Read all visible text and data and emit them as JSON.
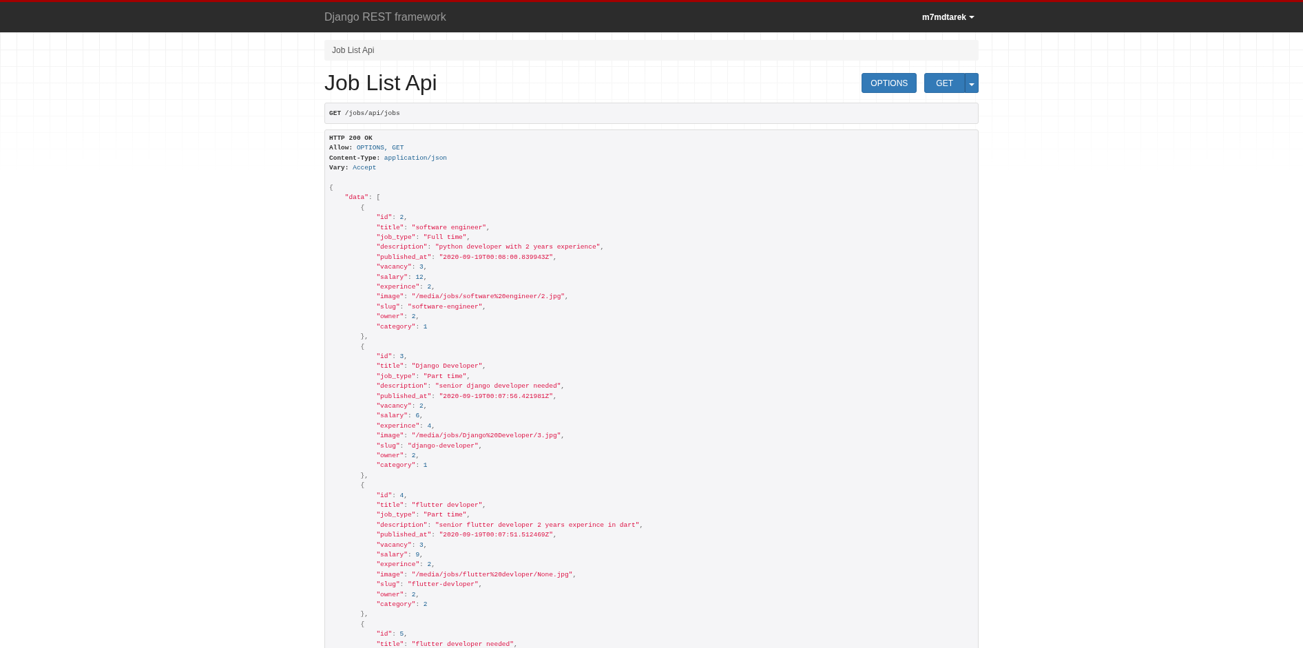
{
  "navbar": {
    "brand": "Django REST framework",
    "user": "m7mdtarek"
  },
  "breadcrumb": [
    {
      "label": "Job List Api",
      "selected": true
    }
  ],
  "title": "Job List Api",
  "buttons": [
    {
      "label": "OPTIONS",
      "kind": "plain"
    },
    {
      "label": "GET",
      "kind": "split"
    }
  ],
  "request": {
    "method": "GET",
    "path": "/jobs/api/jobs"
  },
  "response": {
    "status": "HTTP 200 OK",
    "headers": [
      {
        "name": "Allow:",
        "value": "OPTIONS, GET"
      },
      {
        "name": "Content-Type:",
        "value": "application/json"
      },
      {
        "name": "Vary:",
        "value": "Accept"
      }
    ],
    "body": {
      "open": [
        {
          "text": "{",
          "kind": "pun"
        }
      ],
      "children": [
        {
          "open": [
            {
              "text": "\"data\"",
              "kind": "str"
            },
            {
              "text": ": [",
              "kind": "pun"
            }
          ],
          "children": [
            {
              "open": [
                {
                  "text": "{",
                  "kind": "pun"
                }
              ],
              "children": [
                {
                  "open": [
                    {
                      "text": "\"id\"",
                      "kind": "str"
                    },
                    {
                      "text": ": ",
                      "kind": "pun"
                    },
                    {
                      "text": "2",
                      "kind": "lit"
                    },
                    {
                      "text": ",",
                      "kind": "pun"
                    }
                  ]
                },
                {
                  "open": [
                    {
                      "text": "\"title\"",
                      "kind": "str"
                    },
                    {
                      "text": ": ",
                      "kind": "pun"
                    },
                    {
                      "text": "\"software engineer\"",
                      "kind": "str"
                    },
                    {
                      "text": ",",
                      "kind": "pun"
                    }
                  ]
                },
                {
                  "open": [
                    {
                      "text": "\"job_type\"",
                      "kind": "str"
                    },
                    {
                      "text": ": ",
                      "kind": "pun"
                    },
                    {
                      "text": "\"Full time\"",
                      "kind": "str"
                    },
                    {
                      "text": ",",
                      "kind": "pun"
                    }
                  ]
                },
                {
                  "open": [
                    {
                      "text": "\"description\"",
                      "kind": "str"
                    },
                    {
                      "text": ": ",
                      "kind": "pun"
                    },
                    {
                      "text": "\"python developer with 2 years experience\"",
                      "kind": "str"
                    },
                    {
                      "text": ",",
                      "kind": "pun"
                    }
                  ]
                },
                {
                  "open": [
                    {
                      "text": "\"published_at\"",
                      "kind": "str"
                    },
                    {
                      "text": ": ",
                      "kind": "pun"
                    },
                    {
                      "text": "\"2020-09-19T00:08:00.839943Z\"",
                      "kind": "str"
                    },
                    {
                      "text": ",",
                      "kind": "pun"
                    }
                  ]
                },
                {
                  "open": [
                    {
                      "text": "\"vacancy\"",
                      "kind": "str"
                    },
                    {
                      "text": ": ",
                      "kind": "pun"
                    },
                    {
                      "text": "3",
                      "kind": "lit"
                    },
                    {
                      "text": ",",
                      "kind": "pun"
                    }
                  ]
                },
                {
                  "open": [
                    {
                      "text": "\"salary\"",
                      "kind": "str"
                    },
                    {
                      "text": ": ",
                      "kind": "pun"
                    },
                    {
                      "text": "12",
                      "kind": "lit"
                    },
                    {
                      "text": ",",
                      "kind": "pun"
                    }
                  ]
                },
                {
                  "open": [
                    {
                      "text": "\"experince\"",
                      "kind": "str"
                    },
                    {
                      "text": ": ",
                      "kind": "pun"
                    },
                    {
                      "text": "2",
                      "kind": "lit"
                    },
                    {
                      "text": ",",
                      "kind": "pun"
                    }
                  ]
                },
                {
                  "open": [
                    {
                      "text": "\"image\"",
                      "kind": "str"
                    },
                    {
                      "text": ": ",
                      "kind": "pun"
                    },
                    {
                      "text": "\"/media/jobs/software%20engineer/2.jpg\"",
                      "kind": "str"
                    },
                    {
                      "text": ",",
                      "kind": "pun"
                    }
                  ]
                },
                {
                  "open": [
                    {
                      "text": "\"slug\"",
                      "kind": "str"
                    },
                    {
                      "text": ": ",
                      "kind": "pun"
                    },
                    {
                      "text": "\"software-engineer\"",
                      "kind": "str"
                    },
                    {
                      "text": ",",
                      "kind": "pun"
                    }
                  ]
                },
                {
                  "open": [
                    {
                      "text": "\"owner\"",
                      "kind": "str"
                    },
                    {
                      "text": ": ",
                      "kind": "pun"
                    },
                    {
                      "text": "2",
                      "kind": "lit"
                    },
                    {
                      "text": ",",
                      "kind": "pun"
                    }
                  ]
                },
                {
                  "open": [
                    {
                      "text": "\"category\"",
                      "kind": "str"
                    },
                    {
                      "text": ": ",
                      "kind": "pun"
                    },
                    {
                      "text": "1",
                      "kind": "lit"
                    }
                  ]
                }
              ],
              "close": [
                {
                  "text": "},",
                  "kind": "pun"
                }
              ]
            },
            {
              "open": [
                {
                  "text": "{",
                  "kind": "pun"
                }
              ],
              "children": [
                {
                  "open": [
                    {
                      "text": "\"id\"",
                      "kind": "str"
                    },
                    {
                      "text": ": ",
                      "kind": "pun"
                    },
                    {
                      "text": "3",
                      "kind": "lit"
                    },
                    {
                      "text": ",",
                      "kind": "pun"
                    }
                  ]
                },
                {
                  "open": [
                    {
                      "text": "\"title\"",
                      "kind": "str"
                    },
                    {
                      "text": ": ",
                      "kind": "pun"
                    },
                    {
                      "text": "\"Django Developer\"",
                      "kind": "str"
                    },
                    {
                      "text": ",",
                      "kind": "pun"
                    }
                  ]
                },
                {
                  "open": [
                    {
                      "text": "\"job_type\"",
                      "kind": "str"
                    },
                    {
                      "text": ": ",
                      "kind": "pun"
                    },
                    {
                      "text": "\"Part time\"",
                      "kind": "str"
                    },
                    {
                      "text": ",",
                      "kind": "pun"
                    }
                  ]
                },
                {
                  "open": [
                    {
                      "text": "\"description\"",
                      "kind": "str"
                    },
                    {
                      "text": ": ",
                      "kind": "pun"
                    },
                    {
                      "text": "\"senior django developer needed\"",
                      "kind": "str"
                    },
                    {
                      "text": ",",
                      "kind": "pun"
                    }
                  ]
                },
                {
                  "open": [
                    {
                      "text": "\"published_at\"",
                      "kind": "str"
                    },
                    {
                      "text": ": ",
                      "kind": "pun"
                    },
                    {
                      "text": "\"2020-09-19T00:07:56.421981Z\"",
                      "kind": "str"
                    },
                    {
                      "text": ",",
                      "kind": "pun"
                    }
                  ]
                },
                {
                  "open": [
                    {
                      "text": "\"vacancy\"",
                      "kind": "str"
                    },
                    {
                      "text": ": ",
                      "kind": "pun"
                    },
                    {
                      "text": "2",
                      "kind": "lit"
                    },
                    {
                      "text": ",",
                      "kind": "pun"
                    }
                  ]
                },
                {
                  "open": [
                    {
                      "text": "\"salary\"",
                      "kind": "str"
                    },
                    {
                      "text": ": ",
                      "kind": "pun"
                    },
                    {
                      "text": "6",
                      "kind": "lit"
                    },
                    {
                      "text": ",",
                      "kind": "pun"
                    }
                  ]
                },
                {
                  "open": [
                    {
                      "text": "\"experince\"",
                      "kind": "str"
                    },
                    {
                      "text": ": ",
                      "kind": "pun"
                    },
                    {
                      "text": "4",
                      "kind": "lit"
                    },
                    {
                      "text": ",",
                      "kind": "pun"
                    }
                  ]
                },
                {
                  "open": [
                    {
                      "text": "\"image\"",
                      "kind": "str"
                    },
                    {
                      "text": ": ",
                      "kind": "pun"
                    },
                    {
                      "text": "\"/media/jobs/Django%20Developer/3.jpg\"",
                      "kind": "str"
                    },
                    {
                      "text": ",",
                      "kind": "pun"
                    }
                  ]
                },
                {
                  "open": [
                    {
                      "text": "\"slug\"",
                      "kind": "str"
                    },
                    {
                      "text": ": ",
                      "kind": "pun"
                    },
                    {
                      "text": "\"django-developer\"",
                      "kind": "str"
                    },
                    {
                      "text": ",",
                      "kind": "pun"
                    }
                  ]
                },
                {
                  "open": [
                    {
                      "text": "\"owner\"",
                      "kind": "str"
                    },
                    {
                      "text": ": ",
                      "kind": "pun"
                    },
                    {
                      "text": "2",
                      "kind": "lit"
                    },
                    {
                      "text": ",",
                      "kind": "pun"
                    }
                  ]
                },
                {
                  "open": [
                    {
                      "text": "\"category\"",
                      "kind": "str"
                    },
                    {
                      "text": ": ",
                      "kind": "pun"
                    },
                    {
                      "text": "1",
                      "kind": "lit"
                    }
                  ]
                }
              ],
              "close": [
                {
                  "text": "},",
                  "kind": "pun"
                }
              ]
            },
            {
              "open": [
                {
                  "text": "{",
                  "kind": "pun"
                }
              ],
              "children": [
                {
                  "open": [
                    {
                      "text": "\"id\"",
                      "kind": "str"
                    },
                    {
                      "text": ": ",
                      "kind": "pun"
                    },
                    {
                      "text": "4",
                      "kind": "lit"
                    },
                    {
                      "text": ",",
                      "kind": "pun"
                    }
                  ]
                },
                {
                  "open": [
                    {
                      "text": "\"title\"",
                      "kind": "str"
                    },
                    {
                      "text": ": ",
                      "kind": "pun"
                    },
                    {
                      "text": "\"flutter devloper\"",
                      "kind": "str"
                    },
                    {
                      "text": ",",
                      "kind": "pun"
                    }
                  ]
                },
                {
                  "open": [
                    {
                      "text": "\"job_type\"",
                      "kind": "str"
                    },
                    {
                      "text": ": ",
                      "kind": "pun"
                    },
                    {
                      "text": "\"Part time\"",
                      "kind": "str"
                    },
                    {
                      "text": ",",
                      "kind": "pun"
                    }
                  ]
                },
                {
                  "open": [
                    {
                      "text": "\"description\"",
                      "kind": "str"
                    },
                    {
                      "text": ": ",
                      "kind": "pun"
                    },
                    {
                      "text": "\"senior flutter developer 2 years experince in dart\"",
                      "kind": "str"
                    },
                    {
                      "text": ",",
                      "kind": "pun"
                    }
                  ]
                },
                {
                  "open": [
                    {
                      "text": "\"published_at\"",
                      "kind": "str"
                    },
                    {
                      "text": ": ",
                      "kind": "pun"
                    },
                    {
                      "text": "\"2020-09-19T00:07:51.512469Z\"",
                      "kind": "str"
                    },
                    {
                      "text": ",",
                      "kind": "pun"
                    }
                  ]
                },
                {
                  "open": [
                    {
                      "text": "\"vacancy\"",
                      "kind": "str"
                    },
                    {
                      "text": ": ",
                      "kind": "pun"
                    },
                    {
                      "text": "3",
                      "kind": "lit"
                    },
                    {
                      "text": ",",
                      "kind": "pun"
                    }
                  ]
                },
                {
                  "open": [
                    {
                      "text": "\"salary\"",
                      "kind": "str"
                    },
                    {
                      "text": ": ",
                      "kind": "pun"
                    },
                    {
                      "text": "9",
                      "kind": "lit"
                    },
                    {
                      "text": ",",
                      "kind": "pun"
                    }
                  ]
                },
                {
                  "open": [
                    {
                      "text": "\"experince\"",
                      "kind": "str"
                    },
                    {
                      "text": ": ",
                      "kind": "pun"
                    },
                    {
                      "text": "2",
                      "kind": "lit"
                    },
                    {
                      "text": ",",
                      "kind": "pun"
                    }
                  ]
                },
                {
                  "open": [
                    {
                      "text": "\"image\"",
                      "kind": "str"
                    },
                    {
                      "text": ": ",
                      "kind": "pun"
                    },
                    {
                      "text": "\"/media/jobs/flutter%20devloper/None.jpg\"",
                      "kind": "str"
                    },
                    {
                      "text": ",",
                      "kind": "pun"
                    }
                  ]
                },
                {
                  "open": [
                    {
                      "text": "\"slug\"",
                      "kind": "str"
                    },
                    {
                      "text": ": ",
                      "kind": "pun"
                    },
                    {
                      "text": "\"flutter-devloper\"",
                      "kind": "str"
                    },
                    {
                      "text": ",",
                      "kind": "pun"
                    }
                  ]
                },
                {
                  "open": [
                    {
                      "text": "\"owner\"",
                      "kind": "str"
                    },
                    {
                      "text": ": ",
                      "kind": "pun"
                    },
                    {
                      "text": "2",
                      "kind": "lit"
                    },
                    {
                      "text": ",",
                      "kind": "pun"
                    }
                  ]
                },
                {
                  "open": [
                    {
                      "text": "\"category\"",
                      "kind": "str"
                    },
                    {
                      "text": ": ",
                      "kind": "pun"
                    },
                    {
                      "text": "2",
                      "kind": "lit"
                    }
                  ]
                }
              ],
              "close": [
                {
                  "text": "},",
                  "kind": "pun"
                }
              ]
            },
            {
              "open": [
                {
                  "text": "{",
                  "kind": "pun"
                }
              ],
              "children": [
                {
                  "open": [
                    {
                      "text": "\"id\"",
                      "kind": "str"
                    },
                    {
                      "text": ": ",
                      "kind": "pun"
                    },
                    {
                      "text": "5",
                      "kind": "lit"
                    },
                    {
                      "text": ",",
                      "kind": "pun"
                    }
                  ]
                },
                {
                  "open": [
                    {
                      "text": "\"title\"",
                      "kind": "str"
                    },
                    {
                      "text": ": ",
                      "kind": "pun"
                    },
                    {
                      "text": "\"flutter developer needed\"",
                      "kind": "str"
                    },
                    {
                      "text": ",",
                      "kind": "pun"
                    }
                  ]
                }
              ]
            }
          ]
        }
      ]
    }
  }
}
